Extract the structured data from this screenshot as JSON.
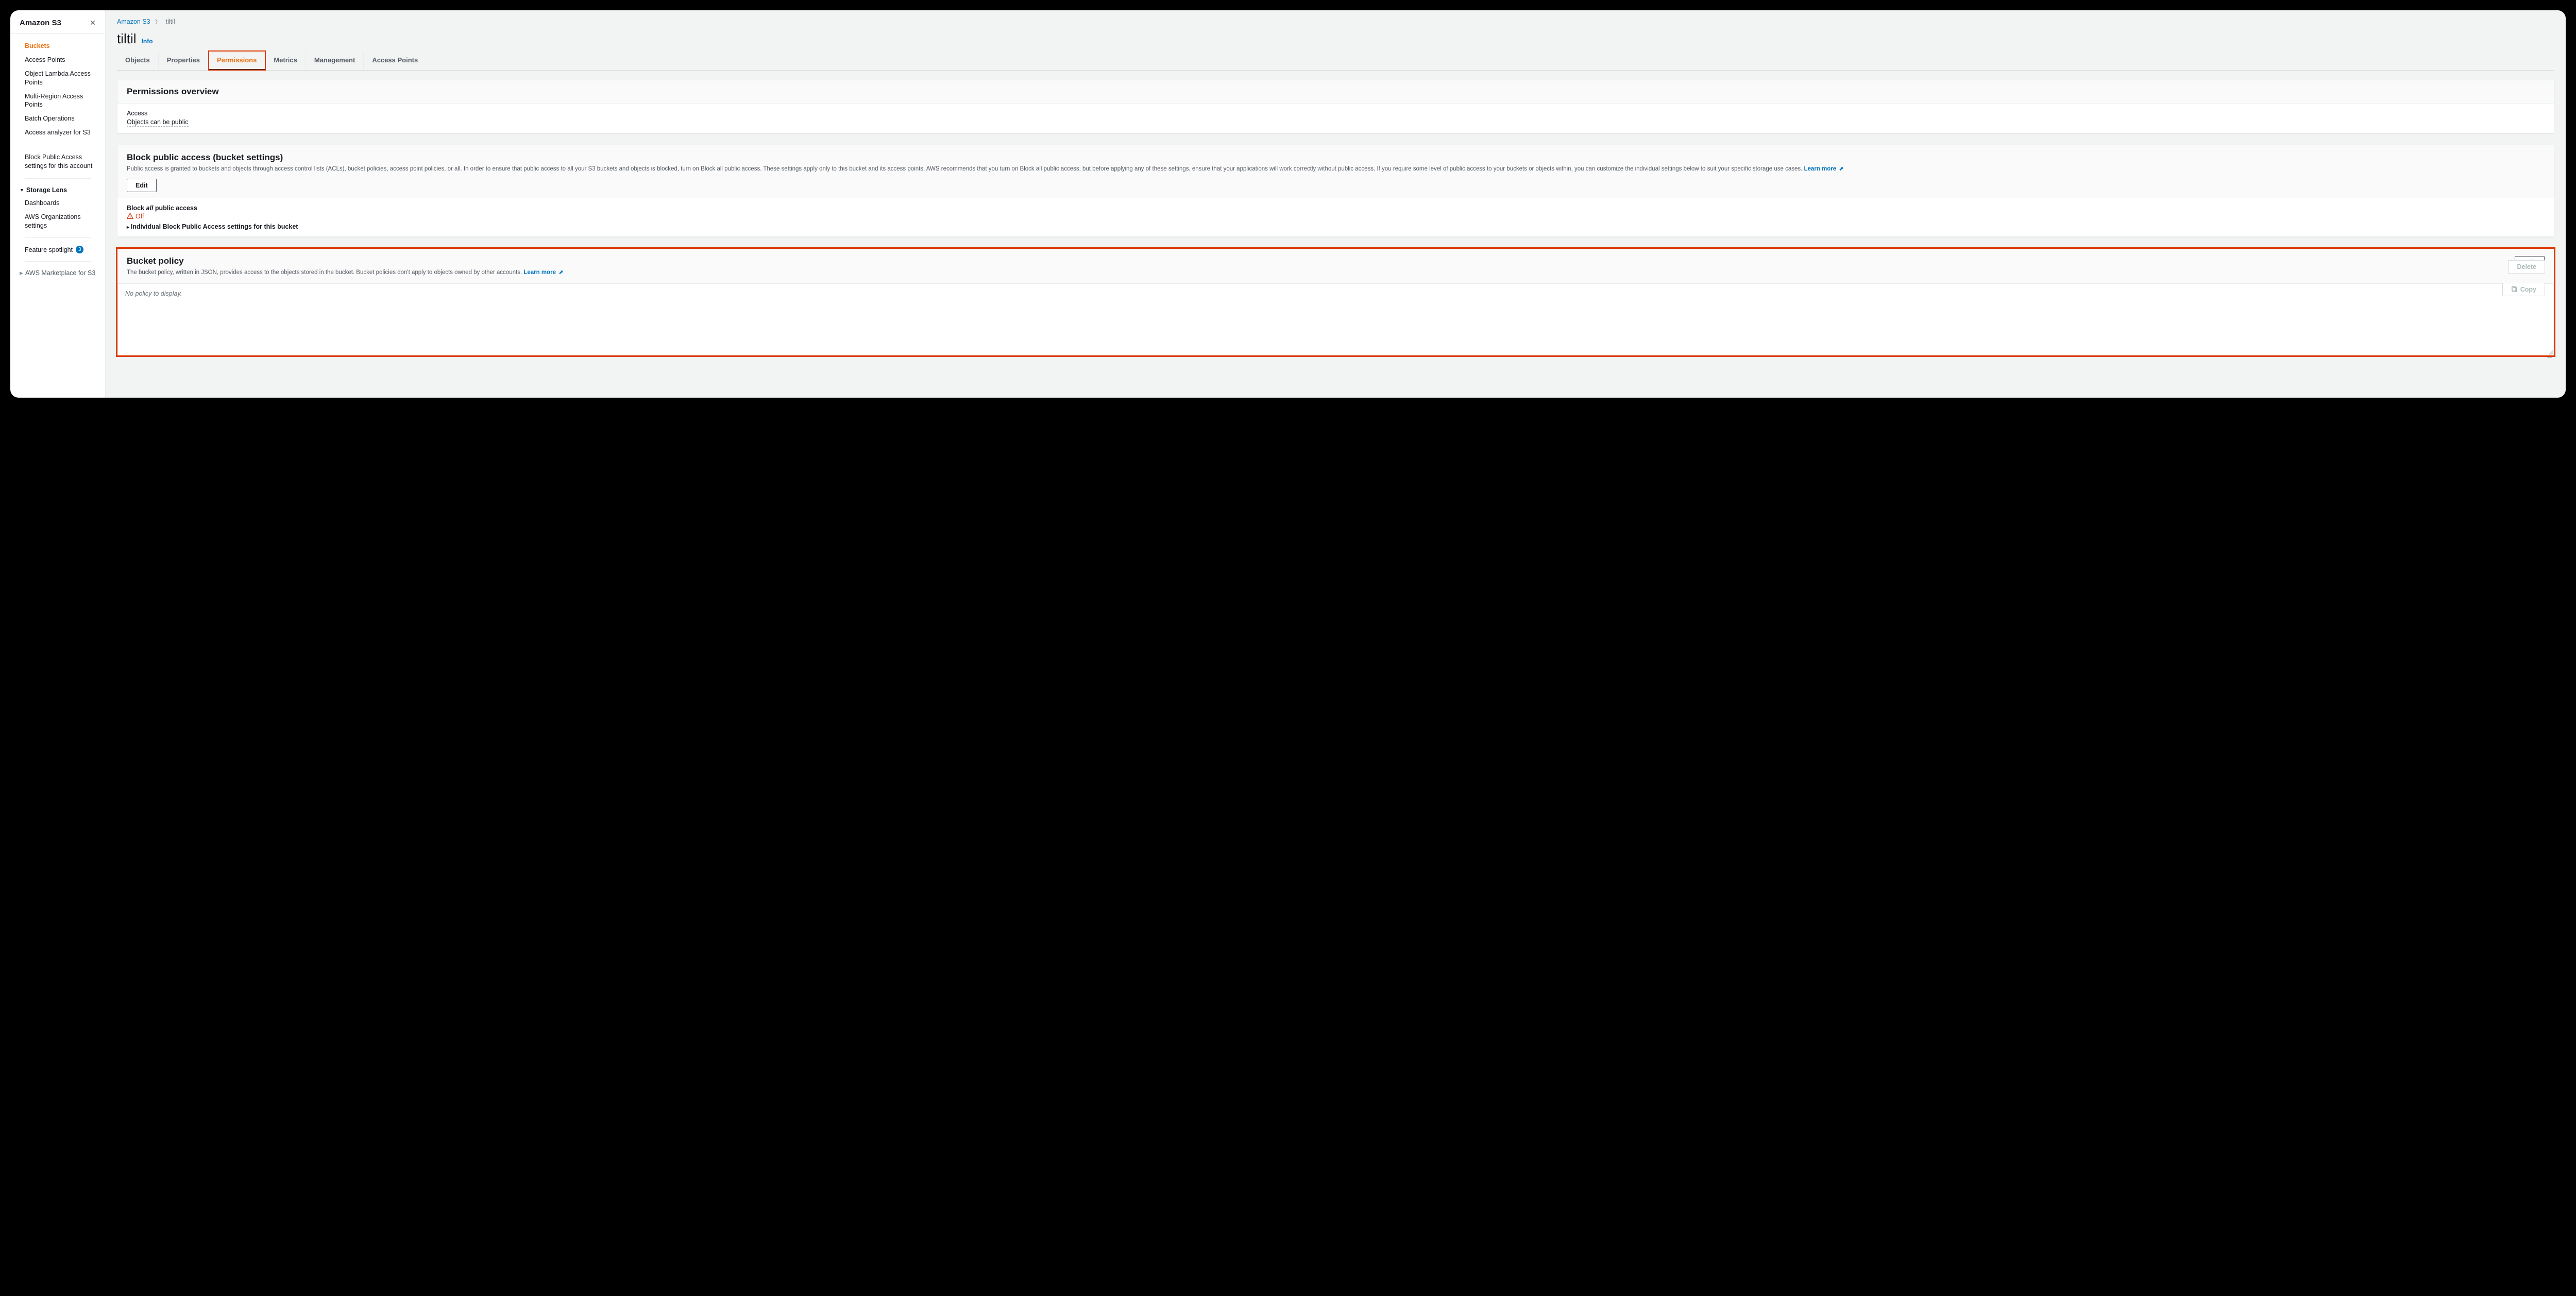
{
  "sidebar": {
    "title": "Amazon S3",
    "items": [
      "Buckets",
      "Access Points",
      "Object Lambda Access Points",
      "Multi-Region Access Points",
      "Batch Operations",
      "Access analyzer for S3"
    ],
    "block_public": "Block Public Access settings for this account",
    "storage_lens_group": "Storage Lens",
    "storage_lens_items": [
      "Dashboards",
      "AWS Organizations settings"
    ],
    "feature_spotlight": "Feature spotlight",
    "feature_badge": "3",
    "marketplace": "AWS Marketplace for S3"
  },
  "breadcrumb": {
    "root": "Amazon S3",
    "current": "tiltil"
  },
  "page": {
    "title": "tiltil",
    "info": "Info"
  },
  "tabs": [
    "Objects",
    "Properties",
    "Permissions",
    "Metrics",
    "Management",
    "Access Points"
  ],
  "active_tab": "Permissions",
  "overview": {
    "heading": "Permissions overview",
    "access_label": "Access",
    "access_value": "Objects can be public"
  },
  "bpa": {
    "heading": "Block public access (bucket settings)",
    "description": "Public access is granted to buckets and objects through access control lists (ACLs), bucket policies, access point policies, or all. In order to ensure that public access to all your S3 buckets and objects is blocked, turn on Block all public access. These settings apply only to this bucket and its access points. AWS recommends that you turn on Block all public access, but before applying any of these settings, ensure that your applications will work correctly without public access. If you require some level of public access to your buckets or objects within, you can customize the individual settings below to suit your specific storage use cases.",
    "learn_more": "Learn more",
    "edit": "Edit",
    "block_prefix": "Block",
    "block_ital": "all",
    "block_suffix": "public access",
    "status": "Off",
    "details": "Individual Block Public Access settings for this bucket"
  },
  "policy": {
    "heading": "Bucket policy",
    "description": "The bucket policy, written in JSON, provides access to the objects stored in the bucket. Bucket policies don't apply to objects owned by other accounts.",
    "learn_more": "Learn more",
    "edit": "Edit",
    "delete": "Delete",
    "copy": "Copy",
    "empty": "No policy to display."
  }
}
